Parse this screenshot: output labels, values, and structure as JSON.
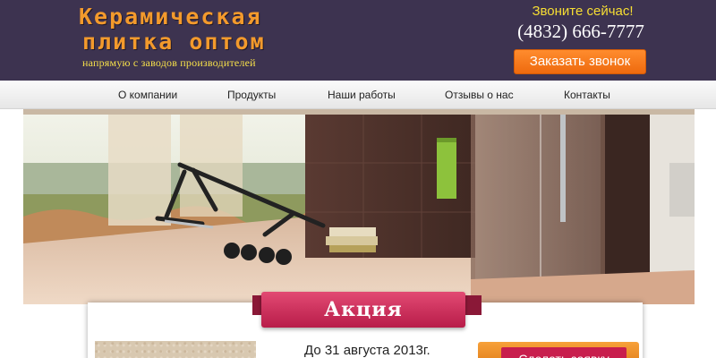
{
  "header": {
    "logo_line1": "Керамическая",
    "logo_line2": "плитка оптом",
    "logo_subtitle": "напрямую с заводов производителей",
    "call_now": "Звоните сейчас!",
    "phone": "(4832) 666-7777",
    "order_call_button": "Заказать звонок"
  },
  "nav": {
    "items": [
      {
        "label": "О компании"
      },
      {
        "label": "Продукты"
      },
      {
        "label": "Наши работы"
      },
      {
        "label": "Отзывы о нас"
      },
      {
        "label": "Контакты"
      }
    ]
  },
  "promo": {
    "ribbon_title": "Акция",
    "date_text": "До 31 августа 2013г.",
    "button_label": "Сделать заявку"
  },
  "colors": {
    "header_bg": "#3d3350",
    "logo_orange": "#f39a2c",
    "accent_yellow": "#f7de33",
    "button_orange": "#ee6a0e",
    "ribbon_crimson": "#c81e4d"
  }
}
